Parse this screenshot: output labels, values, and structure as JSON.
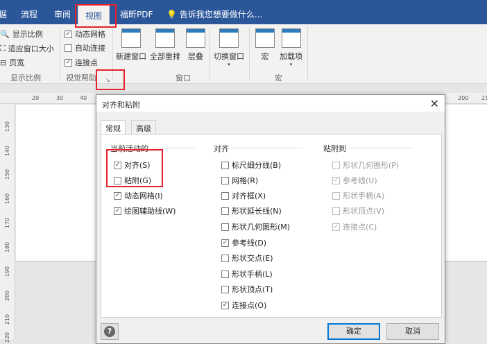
{
  "ribbon_tabs": [
    {
      "label": "据"
    },
    {
      "label": "流程"
    },
    {
      "label": "审阅"
    },
    {
      "label": "视图"
    },
    {
      "label": "福昕PDF"
    }
  ],
  "tell_me": "告诉我您想要做什么...",
  "zoom_group": {
    "label": "显示比例",
    "items": [
      "显示比例",
      "适应窗口大小",
      "页宽"
    ]
  },
  "visual_aids": {
    "label": "视觉帮助",
    "items": [
      {
        "label": "动态网格",
        "checked": true
      },
      {
        "label": "自动连接",
        "checked": false
      },
      {
        "label": "连接点",
        "checked": true
      }
    ]
  },
  "window_group": {
    "label": "窗口",
    "buttons": [
      "新建窗口",
      "全部重排",
      "层叠",
      "切换窗口"
    ]
  },
  "macro_group": {
    "label": "宏",
    "buttons": [
      "宏",
      "加载项"
    ]
  },
  "ruler_top": [
    "20",
    "30",
    "40",
    "200",
    "21"
  ],
  "ruler_left": [
    "130",
    "140",
    "150",
    "160",
    "170",
    "180",
    "190",
    "200",
    "210",
    "220"
  ],
  "dialog": {
    "title": "对齐和粘附",
    "tabs": [
      "常规",
      "高级"
    ],
    "col1": {
      "header": "当前活动的",
      "items": [
        {
          "label": "对齐(S)",
          "checked": true
        },
        {
          "label": "粘附(G)",
          "checked": false
        },
        {
          "label": "动态网格(I)",
          "checked": true
        },
        {
          "label": "绘图辅助线(W)",
          "checked": true
        }
      ]
    },
    "col2": {
      "header": "对齐",
      "items": [
        {
          "label": "标尺细分线(B)",
          "checked": false
        },
        {
          "label": "网格(R)",
          "checked": false
        },
        {
          "label": "对齐框(X)",
          "checked": false
        },
        {
          "label": "形状延长线(N)",
          "checked": false
        },
        {
          "label": "形状几何图形(M)",
          "checked": false
        },
        {
          "label": "参考线(D)",
          "checked": true
        },
        {
          "label": "形状交点(E)",
          "checked": false
        },
        {
          "label": "形状手柄(L)",
          "checked": false
        },
        {
          "label": "形状顶点(T)",
          "checked": false
        },
        {
          "label": "连接点(O)",
          "checked": true
        }
      ]
    },
    "col3": {
      "header": "粘附到",
      "items": [
        {
          "label": "形状几何图形(P)",
          "checked": false
        },
        {
          "label": "参考线(U)",
          "checked": true
        },
        {
          "label": "形状手柄(A)",
          "checked": false
        },
        {
          "label": "形状顶点(V)",
          "checked": false
        },
        {
          "label": "连接点(C)",
          "checked": true
        }
      ]
    },
    "help": "?",
    "ok": "确定",
    "cancel": "取消"
  }
}
